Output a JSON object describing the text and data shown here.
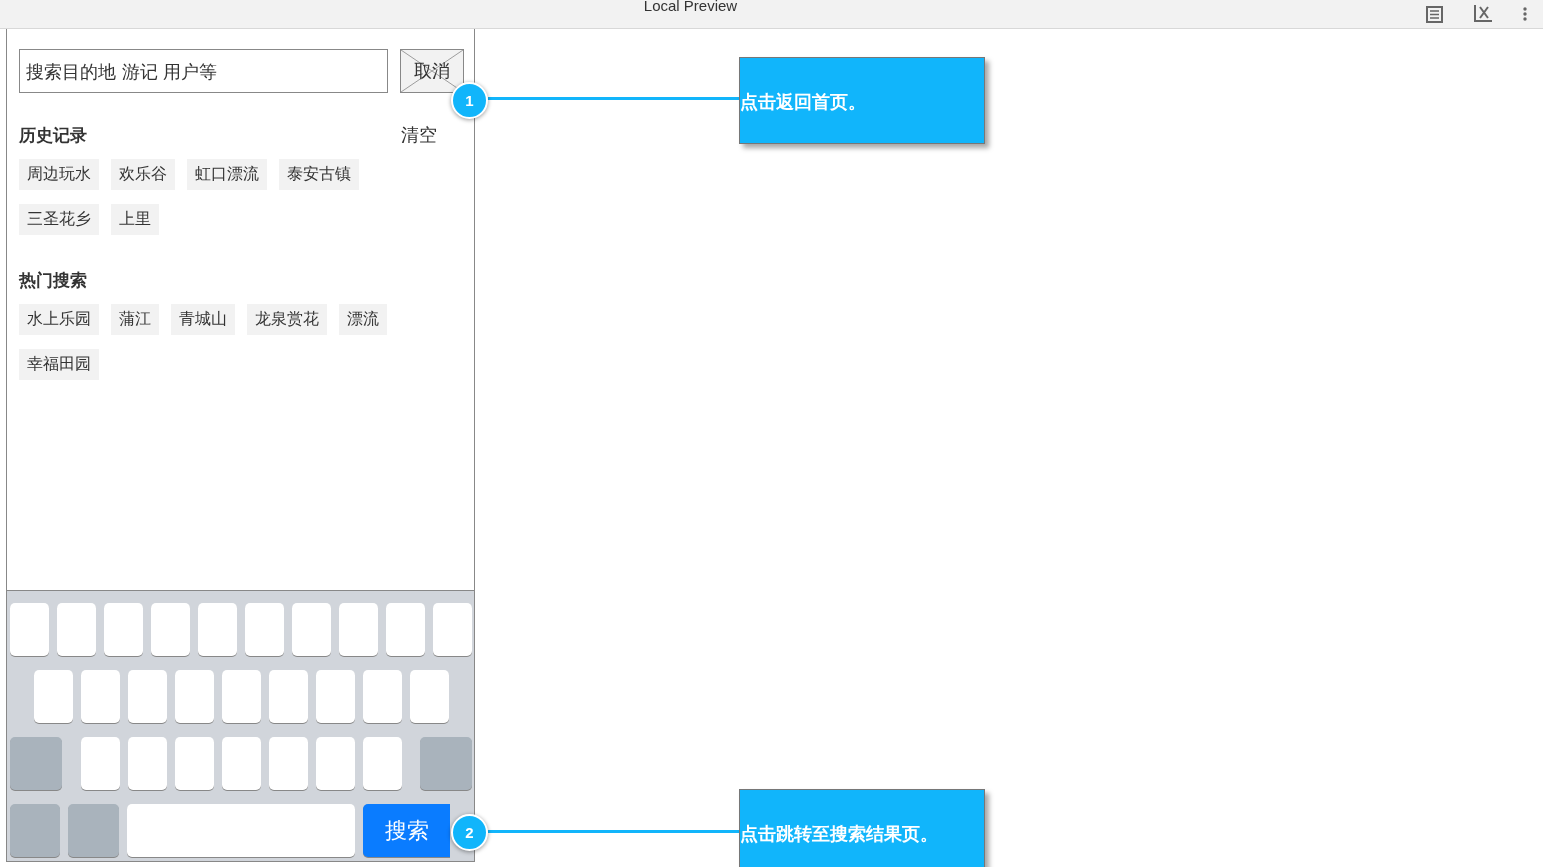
{
  "window": {
    "title": "Local Preview"
  },
  "search": {
    "placeholder": "搜索目的地 游记 用户等",
    "cancel": "取消"
  },
  "history": {
    "title": "历史记录",
    "clear": "清空",
    "tags": [
      "周边玩水",
      "欢乐谷",
      "虹口漂流",
      "泰安古镇",
      "三圣花乡",
      "上里"
    ]
  },
  "hot": {
    "title": "热门搜索",
    "tags": [
      "水上乐园",
      "蒲江",
      "青城山",
      "龙泉赏花",
      "漂流",
      "幸福田园"
    ]
  },
  "keyboard": {
    "search_key": "搜索"
  },
  "annotations": [
    {
      "number": "1",
      "text": "点击返回首页。"
    },
    {
      "number": "2",
      "text": "点击跳转至搜索结果页。"
    }
  ]
}
